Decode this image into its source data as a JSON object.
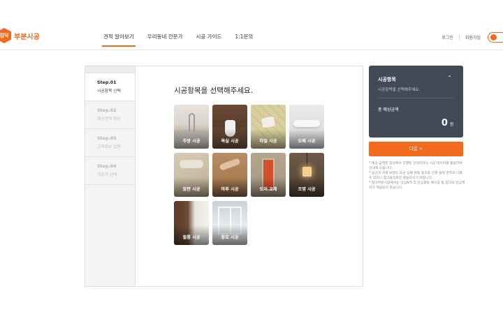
{
  "header": {
    "logo_mark": "집닥",
    "logo_text": "부분시공",
    "nav": [
      {
        "label": "견적 알아보기",
        "active": true
      },
      {
        "label": "우리동네 전문가",
        "active": false
      },
      {
        "label": "시공 가이드",
        "active": false
      },
      {
        "label": "1:1문의",
        "active": false
      }
    ],
    "login": "로그인",
    "signup": "회원가입"
  },
  "steps": [
    {
      "no": "Step.01",
      "name": "시공항목 선택",
      "active": true
    },
    {
      "no": "Step.02",
      "name": "예상견적 확인",
      "active": false
    },
    {
      "no": "Step.03",
      "name": "고객정보 입력",
      "active": false
    },
    {
      "no": "Step.04",
      "name": "전문가 선택",
      "active": false
    }
  ],
  "main": {
    "title": "시공항목을 선택해주세요.",
    "tiles": [
      {
        "label": "주방 시공",
        "icon": "kitchen-photo"
      },
      {
        "label": "욕실 시공",
        "icon": "bathroom-photo"
      },
      {
        "label": "타일 시공",
        "icon": "tile-photo"
      },
      {
        "label": "도배 시공",
        "icon": "wallpaper-photo"
      },
      {
        "label": "장판 시공",
        "icon": "flooring-photo"
      },
      {
        "label": "마루 시공",
        "icon": "wood-floor-photo"
      },
      {
        "label": "도어 교체",
        "icon": "door-photo"
      },
      {
        "label": "조명 시공",
        "icon": "lighting-photo"
      },
      {
        "label": "필름 시공",
        "icon": "film-photo"
      },
      {
        "label": "창호 시공",
        "icon": "window-photo"
      }
    ]
  },
  "summary": {
    "title": "시공항목",
    "desc": "시공항목을 선택해주세요.",
    "estimate_label": "총 예상금액",
    "amount": "0",
    "unit": "원"
  },
  "next_button": "다음 >",
  "notes": [
    "* 예상 금액은 집닥에서 진행된 인테리어의 시공 데이터를 활용하여 안내해 드립니다.",
    "* 공간과 자재 브랜드 또는 상황 변동 등으로 인해 실제 견적과 다를 수 있으니 참고용으로만 활용하시기 바랍니다.",
    "* 집닥부분시공에서는 안심A/S 및 안심출동 예시공 등 집닥의 안심케어가 제공되지 않습니다."
  ],
  "colors": {
    "accent": "#f26a1b",
    "summary_bg": "#434a57"
  }
}
